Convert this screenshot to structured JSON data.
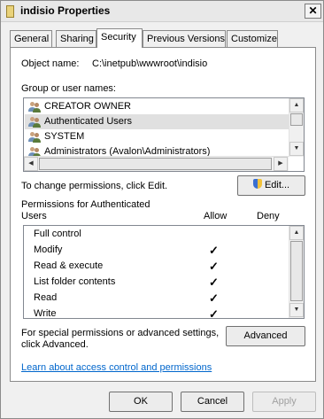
{
  "window": {
    "title": "indisio Properties",
    "close_glyph": "✕"
  },
  "tabs": [
    {
      "label": "General"
    },
    {
      "label": "Sharing"
    },
    {
      "label": "Security",
      "active": true
    },
    {
      "label": "Previous Versions"
    },
    {
      "label": "Customize"
    }
  ],
  "object": {
    "label": "Object name:",
    "value": "C:\\inetpub\\wwwroot\\indisio"
  },
  "groups": {
    "label": "Group or user names:",
    "items": [
      {
        "name": "CREATOR OWNER",
        "icon": "user-group-icon"
      },
      {
        "name": "Authenticated Users",
        "icon": "user-group-icon",
        "selected": true
      },
      {
        "name": "SYSTEM",
        "icon": "user-group-icon"
      },
      {
        "name": "Administrators (Avalon\\Administrators)",
        "icon": "user-group-icon"
      }
    ]
  },
  "change_text": "To change permissions, click Edit.",
  "edit_button": "Edit...",
  "permissions": {
    "label_line1": "Permissions for Authenticated",
    "label_line2": "Users",
    "allow_header": "Allow",
    "deny_header": "Deny",
    "check_glyph": "✓",
    "rows": [
      {
        "name": "Full control",
        "allow": false,
        "deny": false
      },
      {
        "name": "Modify",
        "allow": true,
        "deny": false
      },
      {
        "name": "Read & execute",
        "allow": true,
        "deny": false
      },
      {
        "name": "List folder contents",
        "allow": true,
        "deny": false
      },
      {
        "name": "Read",
        "allow": true,
        "deny": false
      },
      {
        "name": "Write",
        "allow": true,
        "deny": false
      }
    ]
  },
  "special_text_line1": "For special permissions or advanced settings,",
  "special_text_line2": "click Advanced.",
  "advanced_button": "Advanced",
  "learn_link": "Learn about access control and permissions",
  "footer": {
    "ok": "OK",
    "cancel": "Cancel",
    "apply": "Apply"
  }
}
